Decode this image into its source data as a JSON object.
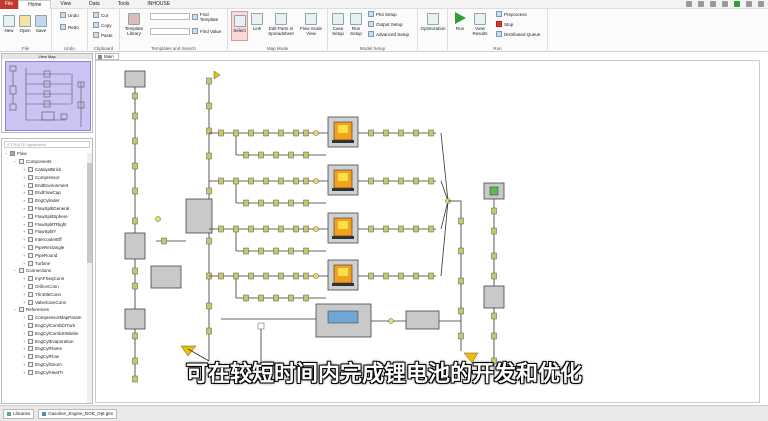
{
  "menu": {
    "file": "File",
    "tabs": [
      "Home",
      "View",
      "Data",
      "Tools",
      "INHOUSE"
    ],
    "active_tab": "Home"
  },
  "ribbon": {
    "file_group": {
      "label": "File",
      "new": "New",
      "open": "Open",
      "save": "Save"
    },
    "undo_group": {
      "label": "Undo",
      "undo": "Undo",
      "redo": "Redo"
    },
    "clipboard_group": {
      "label": "Clipboard",
      "cut": "Cut",
      "copy": "Copy",
      "paste": "Paste"
    },
    "templates_group": {
      "label": "Templates and Search",
      "template_library": "Template Library",
      "find_template": "Find Template",
      "find_value": "Find Value"
    },
    "mapmode_group": {
      "label": "Map Mode",
      "select": "Select",
      "link": "Link",
      "edit_parts": "Edit Parts in Spreadsheet",
      "flow_scale": "Flow Scale View"
    },
    "model_group": {
      "label": "Model Setup",
      "case_setup": "Case Setup",
      "run_setup": "Run Setup",
      "plot_setup": "Plot Setup",
      "output_setup": "Output Setup",
      "advanced_setup": "Advanced Setup"
    },
    "optimization_group": {
      "optimization": "Optimization"
    },
    "run_group": {
      "label": "Run",
      "run": "Run",
      "view_results": "View Results",
      "preprocess": "Preprocess",
      "stop": "Stop",
      "distributed_queue": "Distributed Queue"
    }
  },
  "panes": {
    "map_title": "View Map",
    "search_placeholder": "GT-SUITE Application",
    "canvas_tab": "Main"
  },
  "tree": [
    {
      "level": 0,
      "label": "Flow",
      "toggle": "−"
    },
    {
      "level": 1,
      "label": "Components",
      "toggle": "−"
    },
    {
      "level": 2,
      "label": "CatalystBrick",
      "toggle": "+"
    },
    {
      "level": 2,
      "label": "Compressor",
      "toggle": "+"
    },
    {
      "level": 2,
      "label": "EndEnvironment",
      "toggle": "+"
    },
    {
      "level": 2,
      "label": "EndFlowCap",
      "toggle": "+"
    },
    {
      "level": 2,
      "label": "EngCylinder",
      "toggle": "+"
    },
    {
      "level": 2,
      "label": "FlowSplitGeneral",
      "toggle": "+"
    },
    {
      "level": 2,
      "label": "FlowSplitSphere",
      "toggle": "+"
    },
    {
      "level": 2,
      "label": "FlowSplitTRight",
      "toggle": "+"
    },
    {
      "level": 2,
      "label": "FlowSplitY",
      "toggle": "+"
    },
    {
      "level": 2,
      "label": "IntercoolerEff",
      "toggle": "+"
    },
    {
      "level": 2,
      "label": "PipeRectangle",
      "toggle": "+"
    },
    {
      "level": 2,
      "label": "PipeRound",
      "toggle": "+"
    },
    {
      "level": 2,
      "label": "Turbine",
      "toggle": "+"
    },
    {
      "level": 1,
      "label": "Connections",
      "toggle": "−"
    },
    {
      "level": 2,
      "label": "InjAFSeqConn",
      "toggle": "+"
    },
    {
      "level": 2,
      "label": "OrificeConn",
      "toggle": "+"
    },
    {
      "level": 2,
      "label": "ThrottleConn",
      "toggle": "+"
    },
    {
      "level": 2,
      "label": "ValveCamConn",
      "toggle": "+"
    },
    {
      "level": 1,
      "label": "References",
      "toggle": "−"
    },
    {
      "level": 2,
      "label": "CompressorMapParam",
      "toggle": "+"
    },
    {
      "level": 2,
      "label": "EngCylCombDITurb",
      "toggle": "+"
    },
    {
      "level": 2,
      "label": "EngCylCombSIWiebe",
      "toggle": "+"
    },
    {
      "level": 2,
      "label": "EngCylEvaporation",
      "toggle": "+"
    },
    {
      "level": 2,
      "label": "EngCylFlame",
      "toggle": "+"
    },
    {
      "level": 2,
      "label": "EngCylFlow",
      "toggle": "+"
    },
    {
      "level": 2,
      "label": "EngCylGeom",
      "toggle": "+"
    },
    {
      "level": 2,
      "label": "EngCylHeatTr",
      "toggle": "+"
    }
  ],
  "statusbar": {
    "libraries": "Libraries",
    "file_tab": "Gasoline_Engine_DOE_Opt.gtm"
  },
  "subtitle": "可在较短时间内完成锂电池的开发和优化",
  "colors": {
    "file_red": "#c0392b",
    "map_highlight": "#c9c4f3",
    "component_fill": "#c9c9c9",
    "element_olive": "#c8c86a",
    "element_green": "#5cb85c",
    "element_yellow": "#f0c000"
  }
}
